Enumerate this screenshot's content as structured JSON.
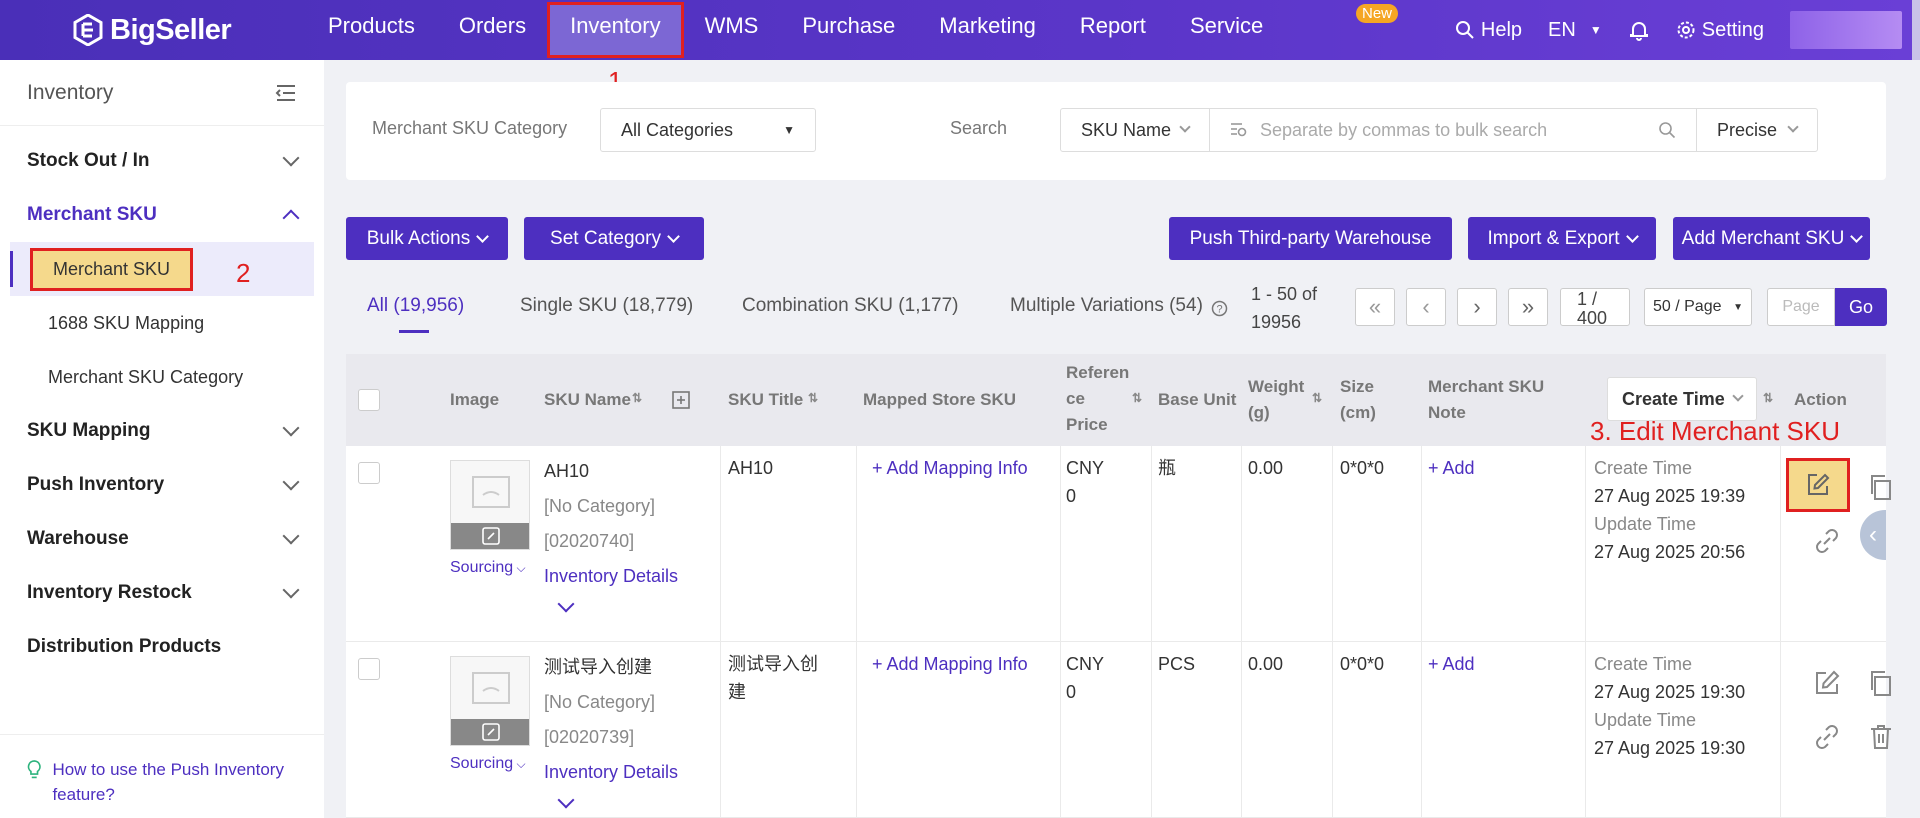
{
  "topbar": {
    "logo": "BigSeller",
    "nav": [
      "Products",
      "Orders",
      "Inventory",
      "WMS",
      "Purchase",
      "Marketing",
      "Report",
      "Service"
    ],
    "help": "Help",
    "lang": "EN",
    "new_badge": "New",
    "setting": "Setting"
  },
  "sidebar": {
    "title": "Inventory",
    "sections": {
      "stock": "Stock Out / In",
      "merchant_sku": "Merchant SKU",
      "sub_merchant_sku": "Merchant SKU",
      "sub_1688": "1688 SKU Mapping",
      "sub_category": "Merchant SKU Category",
      "sku_mapping": "SKU Mapping",
      "push_inventory": "Push Inventory",
      "warehouse": "Warehouse",
      "restock": "Inventory Restock",
      "distribution": "Distribution Products"
    },
    "help_link": "How to use the Push Inventory feature?"
  },
  "annotations": {
    "n1": "1",
    "n2": "2",
    "n3": "3. Edit Merchant SKU"
  },
  "filter": {
    "category_label": "Merchant SKU Category",
    "category_value": "All Categories",
    "search_label": "Search",
    "search_field": "SKU Name",
    "search_placeholder": "Separate by commas to bulk search",
    "match_mode": "Precise"
  },
  "actions": {
    "bulk": "Bulk Actions",
    "set_category": "Set Category",
    "push_third": "Push Third-party Warehouse",
    "import_export": "Import & Export",
    "add_sku": "Add Merchant SKU"
  },
  "tabs": {
    "all": "All (19,956)",
    "single": "Single SKU (18,779)",
    "combo": "Combination SKU (1,177)",
    "multi": "Multiple Variations (54)"
  },
  "pagination": {
    "range_line1": "1 - 50 of",
    "range_line2": "19956",
    "page_line1": "1 /",
    "page_line2": "400",
    "page_size": "50 / Page",
    "page_placeholder": "Page",
    "go": "Go"
  },
  "table": {
    "headers": {
      "image": "Image",
      "sku_name": "SKU Name",
      "sku_title": "SKU Title",
      "mapped": "Mapped Store SKU",
      "ref_price_1": "Referen",
      "ref_price_2": "ce",
      "ref_price_3": "Price",
      "base_unit": "Base Unit",
      "weight_1": "Weight",
      "weight_2": "(g)",
      "size_1": "Size",
      "size_2": "(cm)",
      "note_1": "Merchant SKU",
      "note_2": "Note",
      "create_time": "Create Time",
      "action": "Action"
    },
    "rows": [
      {
        "sku_name": "AH10",
        "category": "[No Category]",
        "code": "[02020740]",
        "inventory_details": "Inventory Details",
        "sourcing": "Sourcing",
        "sku_title_1": "AH10",
        "sku_title_2": "",
        "mapping": "+ Add Mapping Info",
        "price_1": "CNY",
        "price_2": "0",
        "unit": "瓶",
        "weight": "0.00",
        "size": "0*0*0",
        "note": "+ Add",
        "create_label": "Create Time",
        "create_time": "27 Aug 2025 19:39",
        "update_label": "Update Time",
        "update_time": "27 Aug 2025 20:56"
      },
      {
        "sku_name": "测试导入创建",
        "category": "[No Category]",
        "code": "[02020739]",
        "inventory_details": "Inventory Details",
        "sourcing": "Sourcing",
        "sku_title_1": "测试导入创",
        "sku_title_2": "建",
        "mapping": "+ Add Mapping Info",
        "price_1": "CNY",
        "price_2": "0",
        "unit": "PCS",
        "weight": "0.00",
        "size": "0*0*0",
        "note": "+ Add",
        "create_label": "Create Time",
        "create_time": "27 Aug 2025 19:30",
        "update_label": "Update Time",
        "update_time": "27 Aug 2025 19:30"
      }
    ]
  },
  "colors": {
    "brand": "#4d2fc0",
    "annotation": "#e02020",
    "highlight": "#f5d98c"
  }
}
